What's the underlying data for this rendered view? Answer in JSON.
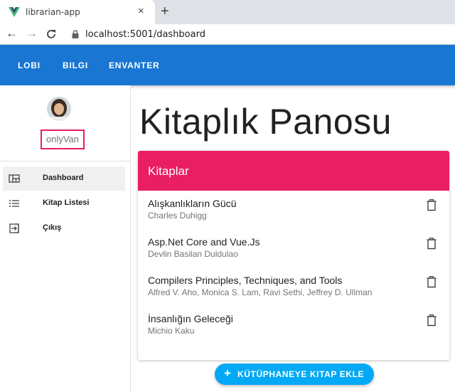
{
  "browser": {
    "tab_title": "librarian-app",
    "close_glyph": "×",
    "new_tab_glyph": "+",
    "back_glyph": "←",
    "forward_glyph": "→",
    "reload_glyph": "C",
    "url": "localhost:5001/dashboard"
  },
  "app_bar": {
    "color": "#1976d2",
    "nav": [
      {
        "label": "LOBI"
      },
      {
        "label": "BILGI"
      },
      {
        "label": "ENVANTER"
      }
    ]
  },
  "drawer": {
    "username": "onlyVan",
    "items": [
      {
        "label": "Dashboard",
        "icon": "dashboard-icon",
        "active": true
      },
      {
        "label": "Kitap Listesi",
        "icon": "list-icon",
        "active": false
      },
      {
        "label": "Çıkış",
        "icon": "logout-icon",
        "active": false
      }
    ]
  },
  "main": {
    "title": "Kitaplık Panosu",
    "card": {
      "title": "Kitaplar",
      "header_color": "#e91e63",
      "books": [
        {
          "title": "Alışkanlıkların Gücü",
          "author": "Charles Duhigg"
        },
        {
          "title": "Asp.Net Core and Vue.Js",
          "author": "Devlin Basilan Duldulao"
        },
        {
          "title": "Compilers Principles, Techniques, and Tools",
          "author": "Alfred V. Aho, Monica S. Lam, Ravi Sethi, Jeffrey D. Ullman"
        },
        {
          "title": "İnsanlığın Geleceği",
          "author": "Michio Kaku"
        }
      ]
    },
    "add_button": {
      "icon": "+",
      "label": "KÜTÜPHANEYE KITAP EKLE",
      "color": "#03a9f4"
    }
  }
}
